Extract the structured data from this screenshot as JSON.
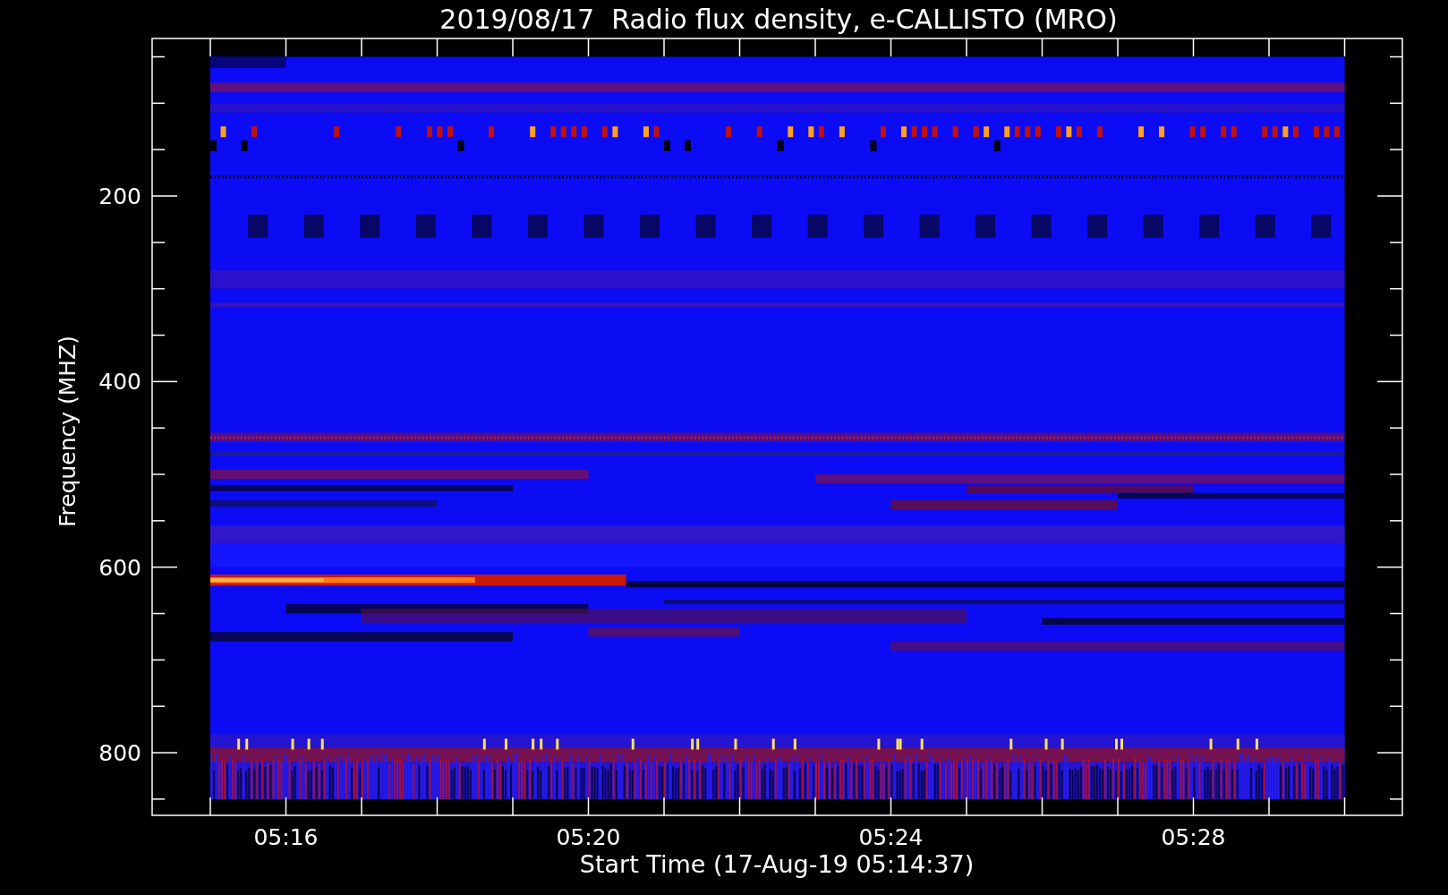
{
  "plot": {
    "title": "2019/08/17  Radio flux density, e-CALLISTO (MRO)",
    "xlabel": "Start Time (17-Aug-19 05:14:37)",
    "ylabel": "Frequency (MHZ)",
    "xticks": [
      {
        "label": "05:16"
      },
      {
        "label": "05:20"
      },
      {
        "label": "05:24"
      },
      {
        "label": "05:28"
      }
    ],
    "yticks": [
      {
        "label": "200"
      },
      {
        "label": "400"
      },
      {
        "label": "600"
      },
      {
        "label": "800"
      }
    ]
  }
}
